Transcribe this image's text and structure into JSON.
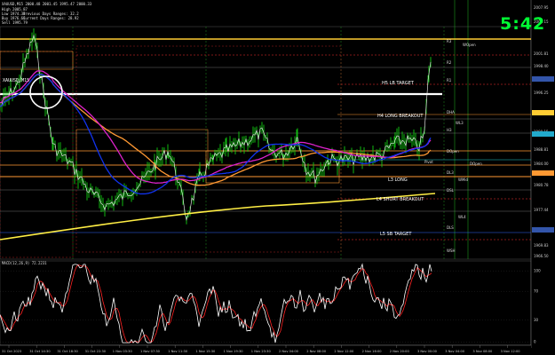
{
  "header": {
    "symbol": "XAUUSD,M15",
    "ohlc_line": "XAUUSD,M15  2000.48 2001.45 1995.47 2000.33",
    "lines": [
      "High 2005.87",
      "Low 1974.31",
      "Buy 1976.61",
      "Sell 1995.79"
    ],
    "range_lines": [
      "Previous Days Ranges: 32.2",
      "Current Days Ranges: 28.92"
    ]
  },
  "clock": {
    "text": "5:42",
    "color": "#00ff33"
  },
  "levels": [
    {
      "label": "R3",
      "kind": "small"
    },
    {
      "label": "WOpen",
      "kind": "small"
    },
    {
      "label": "R2",
      "kind": "small"
    },
    {
      "label": "H5 LB TARGET",
      "kind": "white"
    },
    {
      "label": "R1",
      "kind": "small"
    },
    {
      "label": "H4 LONG BREAKOUT",
      "kind": "white"
    },
    {
      "label": "DHA",
      "kind": "small"
    },
    {
      "label": "WL3",
      "kind": "small"
    },
    {
      "label": "DOpen",
      "kind": "small"
    },
    {
      "label": "H3",
      "kind": "small"
    },
    {
      "label": "Pivot",
      "kind": "small"
    },
    {
      "label": "DOpen",
      "kind": "small"
    },
    {
      "label": "DL3",
      "kind": "small"
    },
    {
      "label": "WMid",
      "kind": "small"
    },
    {
      "label": "L3 LONG",
      "kind": "white"
    },
    {
      "label": "DSL",
      "kind": "small"
    },
    {
      "label": "L4 SHORT BREAKOUT",
      "kind": "white"
    },
    {
      "label": "WL4",
      "kind": "small"
    },
    {
      "label": "L5 SB TARGET",
      "kind": "white"
    },
    {
      "label": "DLS",
      "kind": "small"
    },
    {
      "label": "WSH",
      "kind": "small"
    }
  ],
  "price_axis": [
    "2007.95",
    "2005.15",
    "2001.81",
    "1998.40",
    "1996.25",
    "1993.14",
    "1990.15",
    "1988.81",
    "1984.00",
    "1980.78",
    "1977.44",
    "1974.10",
    "1969.83",
    "1966.50"
  ],
  "oscillator": {
    "title": "MACD(12,26,9) 72.2231",
    "axis": [
      "100",
      "70",
      "30",
      "0"
    ],
    "colors": {
      "main": "#ffffff",
      "signal": "#ff2222"
    }
  },
  "time_axis": [
    "31 Oct 2023",
    "31 Oct 14:30",
    "31 Oct 18:30",
    "31 Oct 22:30",
    "1 Nov 03:30",
    "1 Nov 07:30",
    "1 Nov 11:30",
    "1 Nov 15:30",
    "1 Nov 19:30",
    "1 Nov 23:30",
    "2 Nov 04:00",
    "2 Nov 08:00",
    "2 Nov 12:00",
    "2 Nov 16:00",
    "2 Nov 20:00",
    "3 Nov 00:00",
    "3 Nov 04:00",
    "3 Nov 08:00",
    "3 Nov 12:00"
  ],
  "colors": {
    "candle": "#11cc11",
    "ma_blue": "#1133ee",
    "ma_magenta": "#dd22cc",
    "ma_orange": "#ff9933",
    "ma_yellow": "#ffee44",
    "grid": "#2a2a2a"
  }
}
